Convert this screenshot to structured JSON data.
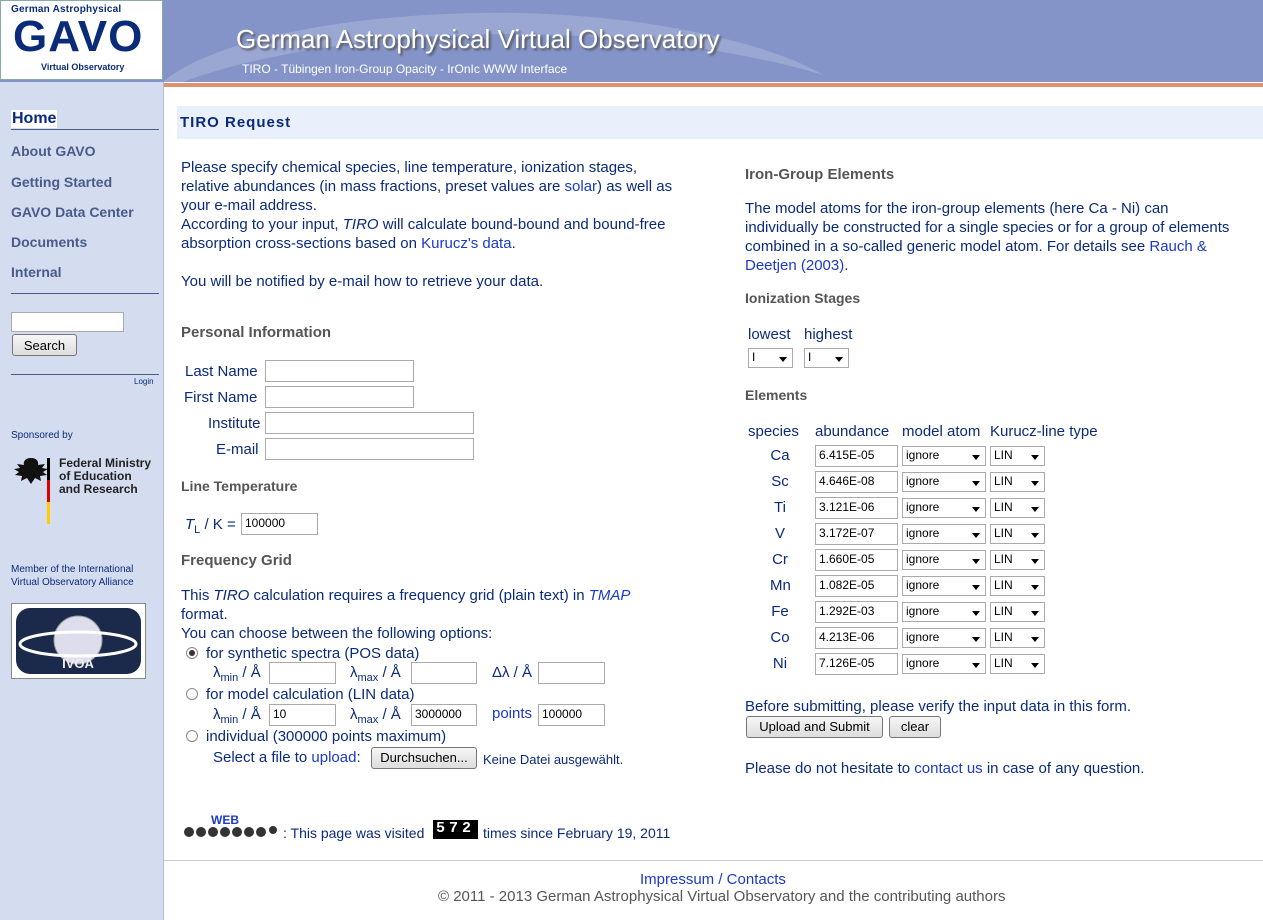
{
  "header": {
    "logo_line1": "German Astrophysical",
    "logo_main": "GAVO",
    "logo_line3": "Virtual Observatory",
    "title": "German Astrophysical Virtual Observatory",
    "subtitle": "TIRO - Tübingen Iron-Group Opacity - IrOnIc WWW Interface"
  },
  "sidebar": {
    "items": [
      {
        "label": "Home"
      },
      {
        "label": "About GAVO"
      },
      {
        "label": "Getting Started"
      },
      {
        "label": "GAVO Data Center"
      },
      {
        "label": "Documents"
      },
      {
        "label": "Internal"
      }
    ],
    "search_button": "Search",
    "login": "Login",
    "sponsored": "Sponsored by",
    "bmbf_1": "Federal Ministry",
    "bmbf_2": "of Education",
    "bmbf_3": "and Research",
    "member_1": "Member of the International",
    "member_2": "Virtual Observatory Alliance",
    "ivoa": "IVOA"
  },
  "main": {
    "title": "TIRO Request",
    "intro_1": "Please specify chemical species, line temperature, ionization stages,",
    "intro_2a": "relative abundances (in mass fractions, preset values are ",
    "intro_2b": "solar",
    "intro_2c": ") as well as",
    "intro_3": "your e-mail address.",
    "intro_4a": "According to your input, ",
    "intro_4b": "TIRO",
    "intro_4c": " will calculate bound-bound and bound-free",
    "intro_5a": "absorption cross-sections based on ",
    "intro_5b": "Kurucz's data",
    "intro_5c": ".",
    "intro_6": "You will be notified by e-mail how to retrieve your data.",
    "personal_heading": "Personal Information",
    "last_name": "Last Name",
    "first_name": "First Name",
    "institute": "Institute",
    "email": "E-mail",
    "line_temp_heading": "Line Temperature",
    "tl_value": "100000",
    "freq_heading": "Frequency Grid",
    "freq_1a": "This ",
    "freq_1b": "TIRO",
    "freq_1c": " calculation requires a frequency grid (plain text) in ",
    "freq_1d": "TMAP",
    "freq_2": "format.",
    "freq_3": "You can choose between the following options:",
    "opt_pos": "for synthetic spectra (POS data)",
    "opt_lin": "for model calculation (LIN data)",
    "opt_ind": "individual (300000 points maximum)",
    "lmin_val": "10",
    "lmax_val": "3000000",
    "points_label": "points",
    "points_val": "100000",
    "select_file_a": "Select a file to ",
    "select_file_b": "upload",
    ":": "",
    "file_button": "Durchsuchen...",
    "no_file": "Keine Datei ausgewählt.",
    "counter_text_a": ": This page was visited ",
    "counter_value": "572",
    "counter_text_b": "times since February 19, 2011"
  },
  "right": {
    "iron_heading": "Iron-Group Elements",
    "iron_1": "The model atoms for the iron-group elements (here Ca - Ni) can",
    "iron_2": "individually be constructed for a single species or for a group of elements",
    "iron_3a": "combined in a so-called generic model atom. For details see ",
    "iron_3b": "Rauch &",
    "iron_4a": "Deetjen (2003)",
    "iron_4b": ".",
    "ion_heading": "Ionization Stages",
    "lowest": "lowest",
    "highest": "highest",
    "lowest_val": "I",
    "highest_val": "I",
    "elements_heading": "Elements",
    "col_species": "species",
    "col_abundance": "abundance",
    "col_model": "model atom",
    "col_kurucz": "Kurucz-line type",
    "rows": [
      {
        "species": "Ca",
        "abundance": "6.415E-05",
        "model": "ignore",
        "kurucz": "LIN"
      },
      {
        "species": "Sc",
        "abundance": "4.646E-08",
        "model": "ignore",
        "kurucz": "LIN"
      },
      {
        "species": "Ti",
        "abundance": "3.121E-06",
        "model": "ignore",
        "kurucz": "LIN"
      },
      {
        "species": "V",
        "abundance": "3.172E-07",
        "model": "ignore",
        "kurucz": "LIN"
      },
      {
        "species": "Cr",
        "abundance": "1.660E-05",
        "model": "ignore",
        "kurucz": "LIN"
      },
      {
        "species": "Mn",
        "abundance": "1.082E-05",
        "model": "ignore",
        "kurucz": "LIN"
      },
      {
        "species": "Fe",
        "abundance": "1.292E-03",
        "model": "ignore",
        "kurucz": "LIN"
      },
      {
        "species": "Co",
        "abundance": "4.213E-06",
        "model": "ignore",
        "kurucz": "LIN"
      },
      {
        "species": "Ni",
        "abundance": "7.126E-05",
        "model": "ignore",
        "kurucz": "LIN"
      }
    ],
    "verify": "Before submitting, please verify the input data in this form.",
    "submit": "Upload and Submit",
    "clear": "clear",
    "contact_a": "Please do not hesitate to ",
    "contact_b": "contact us",
    "contact_c": " in case of any question."
  },
  "footer": {
    "impressum": "Impressum / Contacts",
    "copyright": "© 2011 - 2013 German Astrophysical Virtual Observatory and the contributing authors"
  }
}
